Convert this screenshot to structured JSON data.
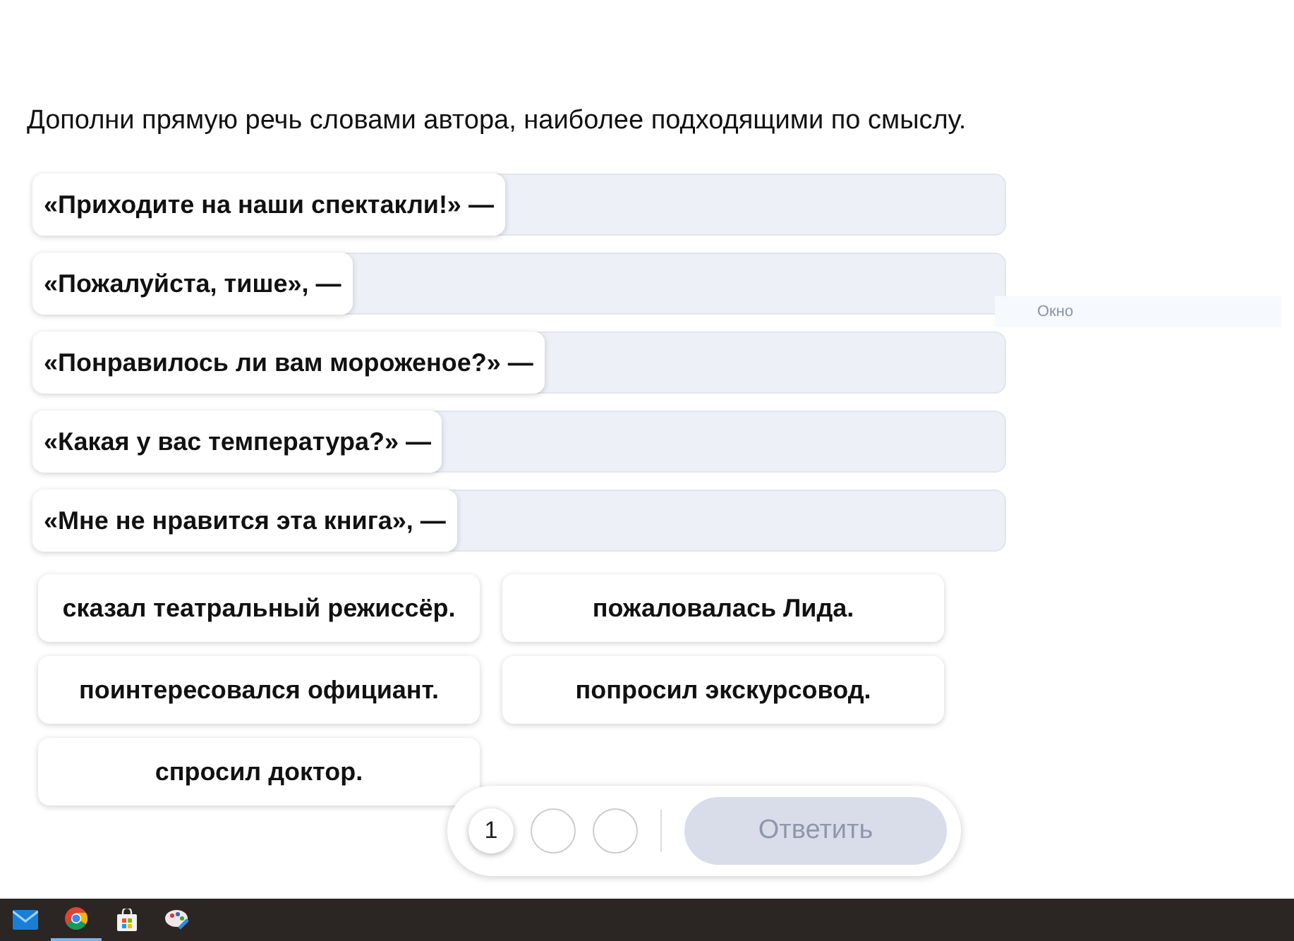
{
  "instruction": "Дополни прямую речь словами автора, наиболее подходящими по смыслу.",
  "statements": [
    {
      "text": "«Приходите на наши спектакли!» —"
    },
    {
      "text": "«Пожалуйста, тише», —"
    },
    {
      "text": "«Понравилось ли вам мороженое?» —"
    },
    {
      "text": "«Какая у вас температура?» —"
    },
    {
      "text": "«Мне не нравится эта книга», —"
    }
  ],
  "options": [
    {
      "text": "сказал театральный режиссёр."
    },
    {
      "text": "пожаловалась Лида."
    },
    {
      "text": "поинтересовался официант."
    },
    {
      "text": "попросил экскурсовод."
    },
    {
      "text": "спросил доктор."
    }
  ],
  "tooltip": "Окно",
  "pager": [
    {
      "label": "1",
      "selected": true
    },
    {
      "selected": false
    },
    {
      "selected": false
    }
  ],
  "submit": {
    "label": "Ответить",
    "disabled": true
  },
  "taskbar": {
    "items": [
      {
        "kind": "mail",
        "active": false
      },
      {
        "kind": "browser",
        "active": true
      },
      {
        "kind": "store",
        "active": false
      },
      {
        "kind": "paint",
        "active": false
      }
    ]
  }
}
